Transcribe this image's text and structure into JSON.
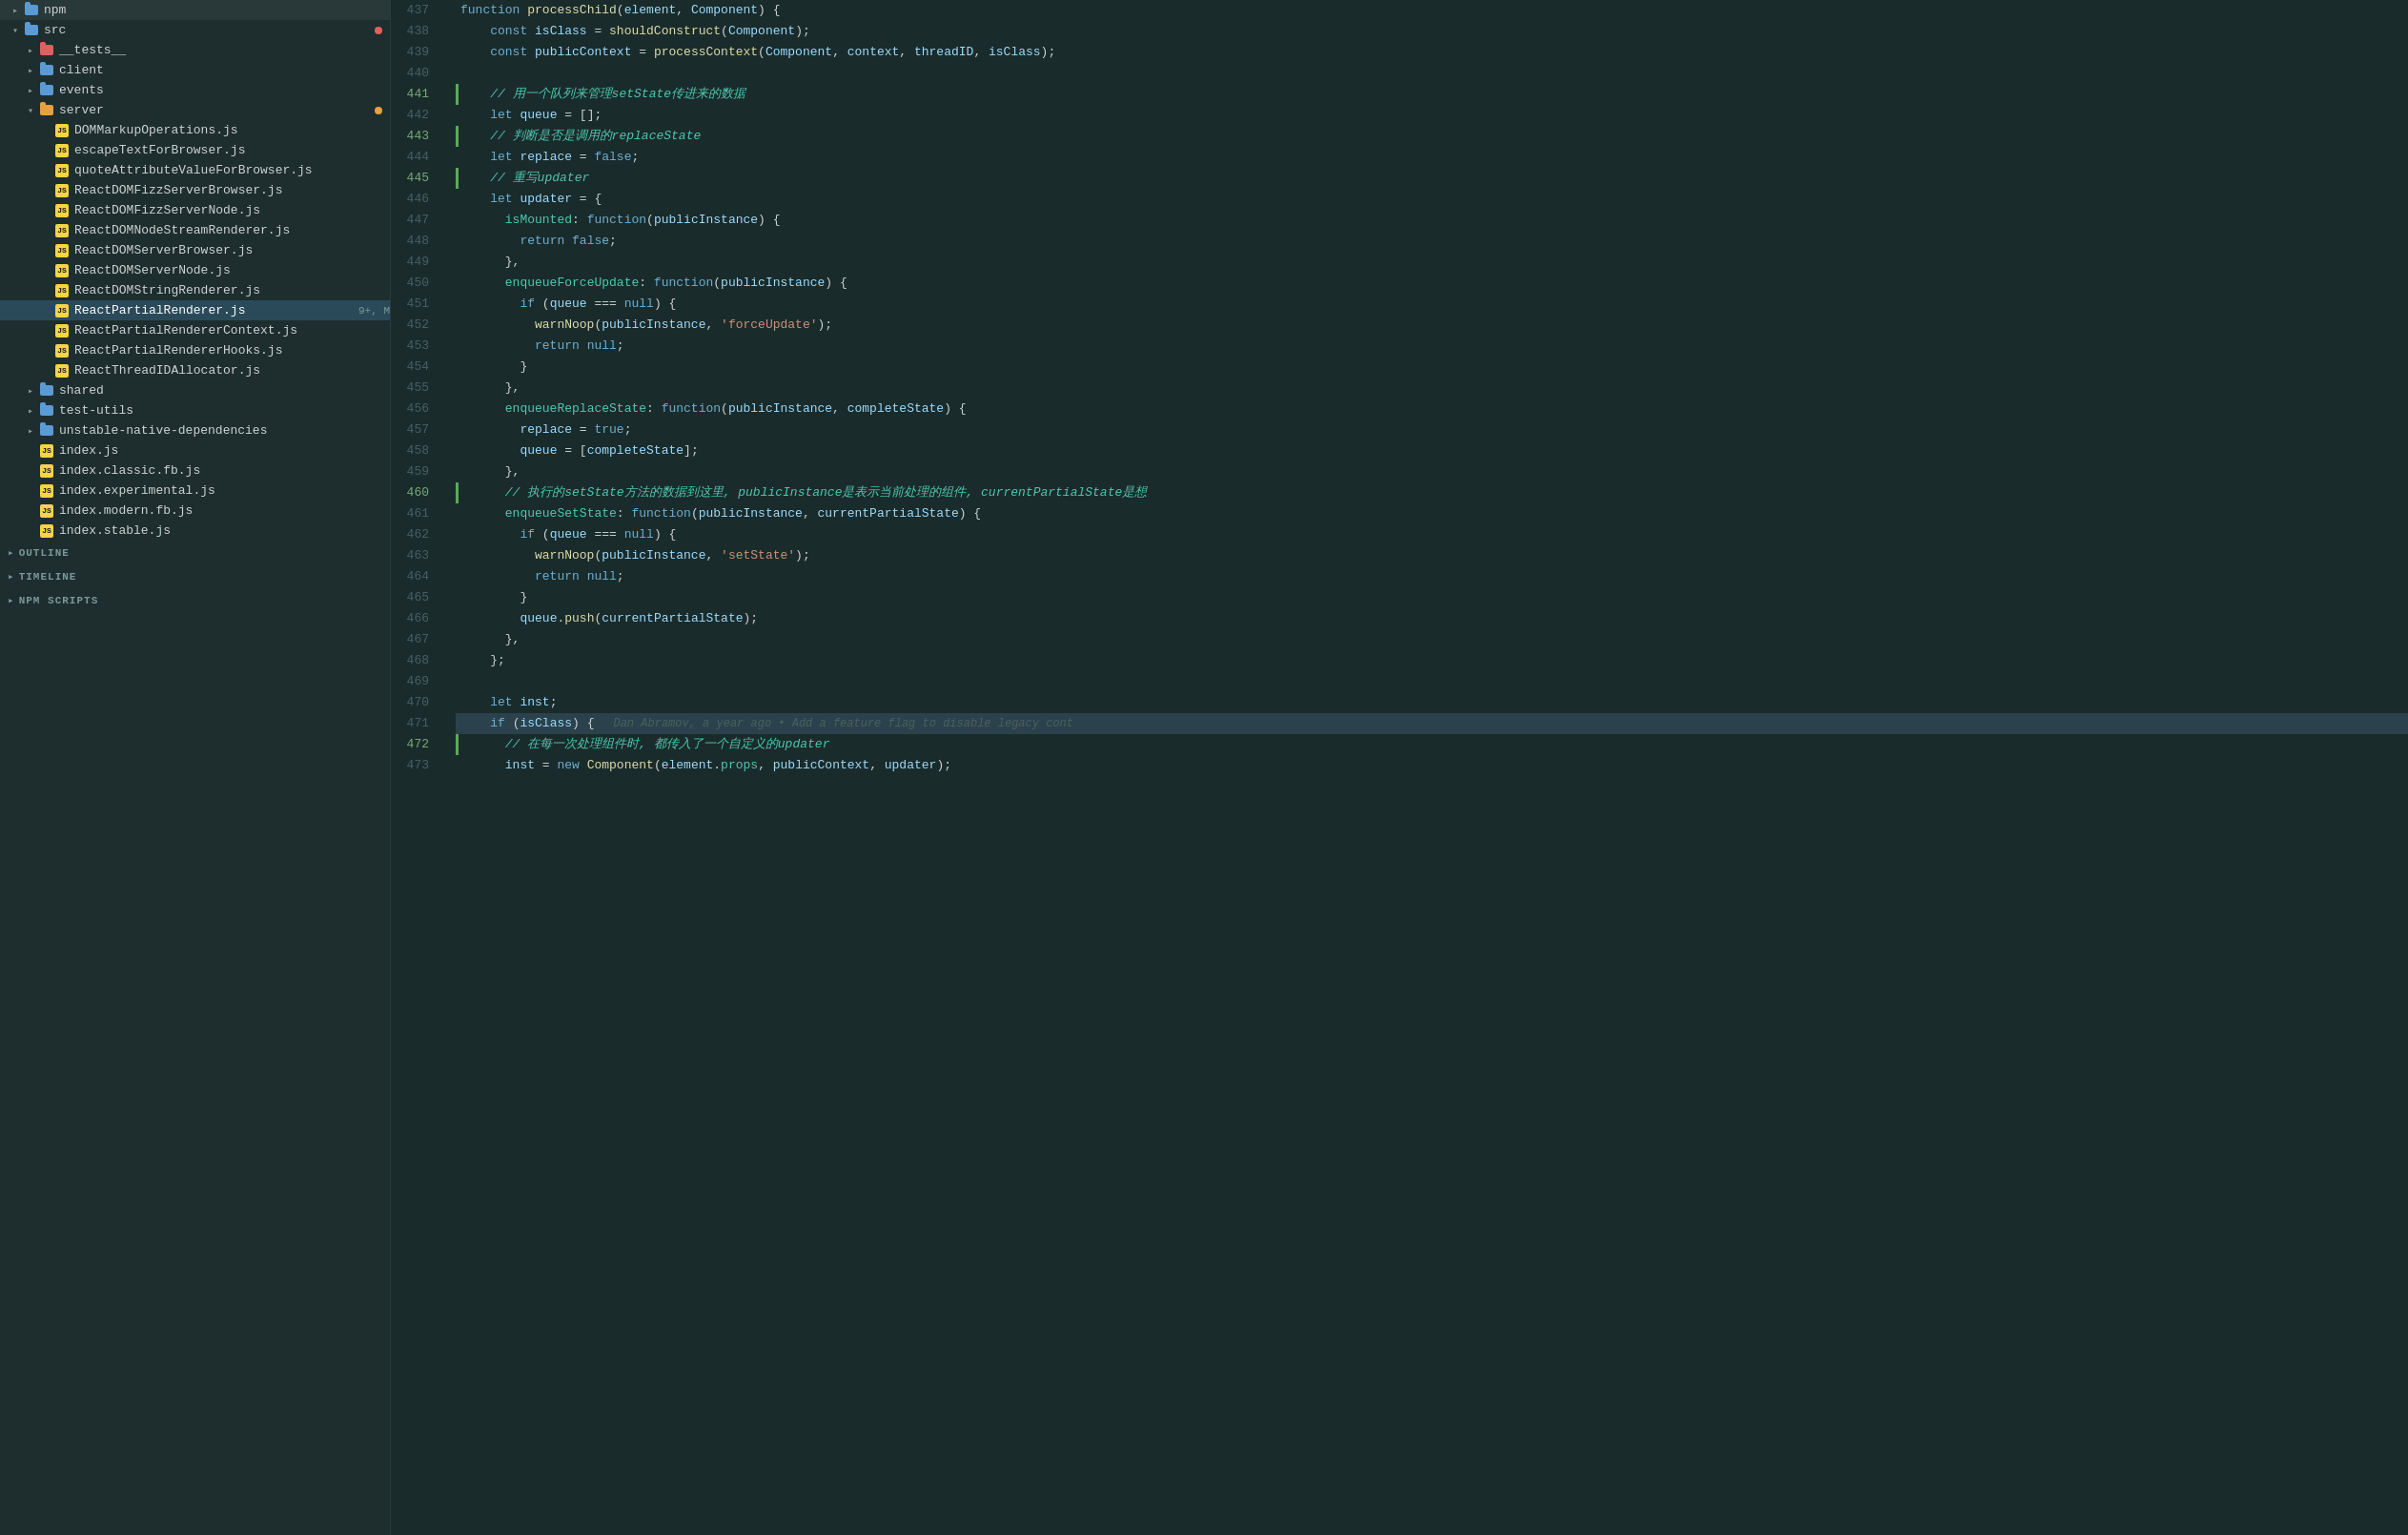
{
  "sidebar": {
    "tree": [
      {
        "id": "npm",
        "level": 0,
        "type": "folder",
        "color": "blue",
        "expanded": false,
        "label": "npm",
        "badge": null
      },
      {
        "id": "src",
        "level": 0,
        "type": "folder",
        "color": "blue",
        "expanded": true,
        "label": "src",
        "badge": "red"
      },
      {
        "id": "__tests__",
        "level": 1,
        "type": "folder",
        "color": "red",
        "expanded": false,
        "label": "__tests__",
        "badge": null
      },
      {
        "id": "client",
        "level": 1,
        "type": "folder",
        "color": "blue",
        "expanded": false,
        "label": "client",
        "badge": null
      },
      {
        "id": "events",
        "level": 1,
        "type": "folder",
        "color": "blue",
        "expanded": false,
        "label": "events",
        "badge": null
      },
      {
        "id": "server",
        "level": 1,
        "type": "folder",
        "color": "orange",
        "expanded": true,
        "label": "server",
        "badge": "orange"
      },
      {
        "id": "DOMMarkupOperations",
        "level": 2,
        "type": "js",
        "label": "DOMMarkupOperations.js",
        "badge": null
      },
      {
        "id": "escapeTextForBrowser",
        "level": 2,
        "type": "js",
        "label": "escapeTextForBrowser.js",
        "badge": null
      },
      {
        "id": "quoteAttributeValueForBrowser",
        "level": 2,
        "type": "js",
        "label": "quoteAttributeValueForBrowser.js",
        "badge": null
      },
      {
        "id": "ReactDOMFizzServerBrowser",
        "level": 2,
        "type": "js",
        "label": "ReactDOMFizzServerBrowser.js",
        "badge": null
      },
      {
        "id": "ReactDOMFizzServerNode",
        "level": 2,
        "type": "js",
        "label": "ReactDOMFizzServerNode.js",
        "badge": null
      },
      {
        "id": "ReactDOMNodeStreamRenderer",
        "level": 2,
        "type": "js",
        "label": "ReactDOMNodeStreamRenderer.js",
        "badge": null
      },
      {
        "id": "ReactDOMServerBrowser",
        "level": 2,
        "type": "js",
        "label": "ReactDOMServerBrowser.js",
        "badge": null
      },
      {
        "id": "ReactDOMServerNode",
        "level": 2,
        "type": "js",
        "label": "ReactDOMServerNode.js",
        "badge": null
      },
      {
        "id": "ReactDOMStringRenderer",
        "level": 2,
        "type": "js",
        "label": "ReactDOMStringRenderer.js",
        "badge": null
      },
      {
        "id": "ReactPartialRenderer",
        "level": 2,
        "type": "js",
        "label": "ReactPartialRenderer.js",
        "badge": null,
        "active": true,
        "badge_text": "9+, M"
      },
      {
        "id": "ReactPartialRendererContext",
        "level": 2,
        "type": "js",
        "label": "ReactPartialRendererContext.js",
        "badge": null
      },
      {
        "id": "ReactPartialRendererHooks",
        "level": 2,
        "type": "js",
        "label": "ReactPartialRendererHooks.js",
        "badge": null
      },
      {
        "id": "ReactThreadIDAllocator",
        "level": 2,
        "type": "js",
        "label": "ReactThreadIDAllocator.js",
        "badge": null
      },
      {
        "id": "shared",
        "level": 1,
        "type": "folder",
        "color": "blue",
        "expanded": false,
        "label": "shared",
        "badge": null
      },
      {
        "id": "test-utils",
        "level": 1,
        "type": "folder",
        "color": "blue",
        "expanded": false,
        "label": "test-utils",
        "badge": null
      },
      {
        "id": "unstable-native-dependencies",
        "level": 1,
        "type": "folder",
        "color": "blue",
        "expanded": false,
        "label": "unstable-native-dependencies",
        "badge": null
      },
      {
        "id": "index.js",
        "level": 1,
        "type": "js",
        "label": "index.js",
        "badge": null
      },
      {
        "id": "index.classic.fb.js",
        "level": 1,
        "type": "js",
        "label": "index.classic.fb.js",
        "badge": null
      },
      {
        "id": "index.experimental.js",
        "level": 1,
        "type": "js",
        "label": "index.experimental.js",
        "badge": null
      },
      {
        "id": "index.modern.fb.js",
        "level": 1,
        "type": "js",
        "label": "index.modern.fb.js",
        "badge": null
      },
      {
        "id": "index.stable.js",
        "level": 1,
        "type": "js",
        "label": "index.stable.js",
        "badge": null
      }
    ],
    "sections": [
      {
        "id": "outline",
        "label": "OUTLINE"
      },
      {
        "id": "timeline",
        "label": "TIMELINE"
      },
      {
        "id": "npm-scripts",
        "label": "NPM SCRIPTS"
      }
    ]
  },
  "editor": {
    "lines": [
      {
        "num": 437,
        "git": false,
        "content": "function processChild(element, Component) {",
        "active": false
      },
      {
        "num": 438,
        "git": false,
        "content": "    const isClass = shouldConstruct(Component);",
        "active": false
      },
      {
        "num": 439,
        "git": false,
        "content": "    const publicContext = processContext(Component, context, threadID, isClass);",
        "active": false
      },
      {
        "num": 440,
        "git": false,
        "content": "",
        "active": false
      },
      {
        "num": 441,
        "git": true,
        "content": "    // 用一个队列来管理setState传进来的数据",
        "active": false
      },
      {
        "num": 442,
        "git": false,
        "content": "    let queue = [];",
        "active": false
      },
      {
        "num": 443,
        "git": true,
        "content": "    // 判断是否是调用的replaceState",
        "active": false
      },
      {
        "num": 444,
        "git": false,
        "content": "    let replace = false;",
        "active": false
      },
      {
        "num": 445,
        "git": true,
        "content": "    // 重写updater",
        "active": false
      },
      {
        "num": 446,
        "git": false,
        "content": "    let updater = {",
        "active": false
      },
      {
        "num": 447,
        "git": false,
        "content": "      isMounted: function(publicInstance) {",
        "active": false
      },
      {
        "num": 448,
        "git": false,
        "content": "        return false;",
        "active": false
      },
      {
        "num": 449,
        "git": false,
        "content": "      },",
        "active": false
      },
      {
        "num": 450,
        "git": false,
        "content": "      enqueueForceUpdate: function(publicInstance) {",
        "active": false
      },
      {
        "num": 451,
        "git": false,
        "content": "        if (queue === null) {",
        "active": false
      },
      {
        "num": 452,
        "git": false,
        "content": "          warnNoop(publicInstance, 'forceUpdate');",
        "active": false
      },
      {
        "num": 453,
        "git": false,
        "content": "          return null;",
        "active": false
      },
      {
        "num": 454,
        "git": false,
        "content": "        }",
        "active": false
      },
      {
        "num": 455,
        "git": false,
        "content": "      },",
        "active": false
      },
      {
        "num": 456,
        "git": false,
        "content": "      enqueueReplaceState: function(publicInstance, completeState) {",
        "active": false
      },
      {
        "num": 457,
        "git": false,
        "content": "        replace = true;",
        "active": false
      },
      {
        "num": 458,
        "git": false,
        "content": "        queue = [completeState];",
        "active": false
      },
      {
        "num": 459,
        "git": false,
        "content": "      },",
        "active": false
      },
      {
        "num": 460,
        "git": true,
        "content": "      // 执行的setState方法的数据到这里, publicInstance是表示当前处理的组件, currentPartialState是想",
        "active": false
      },
      {
        "num": 461,
        "git": false,
        "content": "      enqueueSetState: function(publicInstance, currentPartialState) {",
        "active": false
      },
      {
        "num": 462,
        "git": false,
        "content": "        if (queue === null) {",
        "active": false
      },
      {
        "num": 463,
        "git": false,
        "content": "          warnNoop(publicInstance, 'setState');",
        "active": false
      },
      {
        "num": 464,
        "git": false,
        "content": "          return null;",
        "active": false
      },
      {
        "num": 465,
        "git": false,
        "content": "        }",
        "active": false
      },
      {
        "num": 466,
        "git": false,
        "content": "        queue.push(currentPartialState);",
        "active": false
      },
      {
        "num": 467,
        "git": false,
        "content": "      },",
        "active": false
      },
      {
        "num": 468,
        "git": false,
        "content": "    };",
        "active": false
      },
      {
        "num": 469,
        "git": false,
        "content": "",
        "active": false
      },
      {
        "num": 470,
        "git": false,
        "content": "    let inst;",
        "active": false
      },
      {
        "num": 471,
        "git": false,
        "content": "    if (isClass) {",
        "active": true,
        "blame": "Dan Abramov, a year ago • Add a feature flag to disable legacy cont"
      },
      {
        "num": 472,
        "git": true,
        "content": "      // 在每一次处理组件时, 都传入了一个自定义的updater",
        "active": false
      },
      {
        "num": 473,
        "git": false,
        "content": "      inst = new Component(element.props, publicContext, updater);",
        "active": false
      }
    ]
  }
}
